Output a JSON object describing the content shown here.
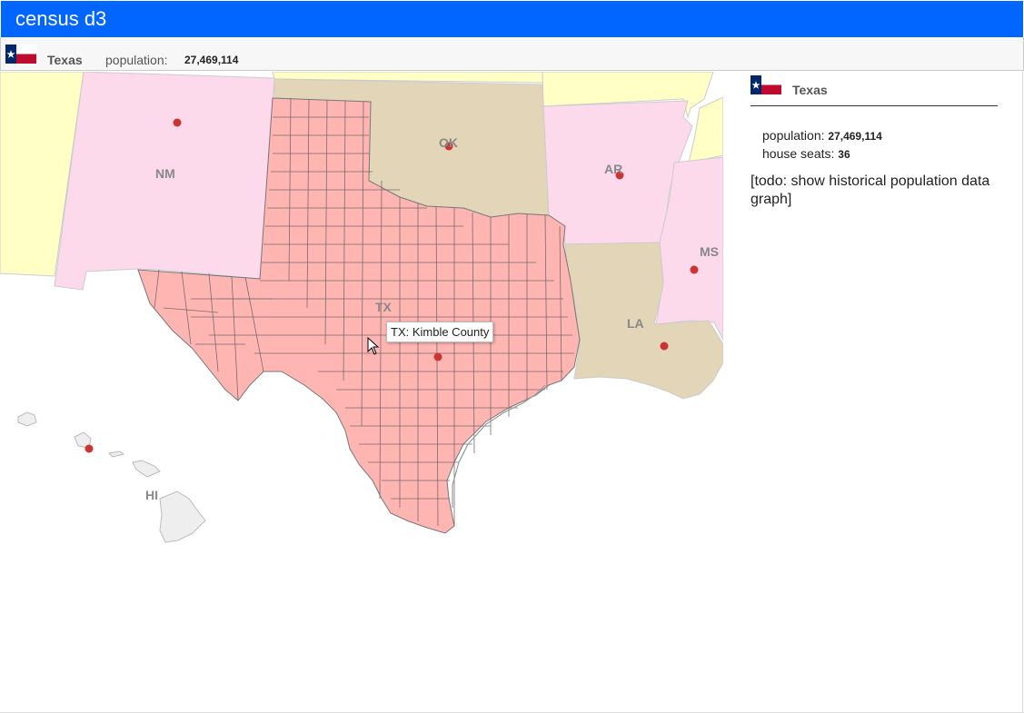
{
  "app": {
    "title": "census d3"
  },
  "selected_state": {
    "name": "Texas",
    "population_label": "population:",
    "population": "27,469,114",
    "house_seats_label": "house seats:",
    "house_seats": "36"
  },
  "map": {
    "state_labels": {
      "nm": "NM",
      "ok": "OK",
      "ar": "AR",
      "ms": "MS",
      "la": "LA",
      "tx": "TX",
      "hi": "HI"
    },
    "tooltip": "TX: Kimble County"
  },
  "panel": {
    "todo": "[todo: show historical population data graph]"
  },
  "colors": {
    "header": "#0066ff",
    "county_fill": "#ffb6b2",
    "pink_state": "#fdd9ec",
    "tan_state": "#e3d6b8",
    "yellow_state": "#ffffc6",
    "grey_state": "#eeeeee",
    "capital_dot": "#cc3333",
    "flag_red": "#bf0a30",
    "flag_blue": "#002868"
  },
  "icons": {
    "flag": "texas-flag-icon",
    "cursor": "mouse-pointer-icon"
  }
}
